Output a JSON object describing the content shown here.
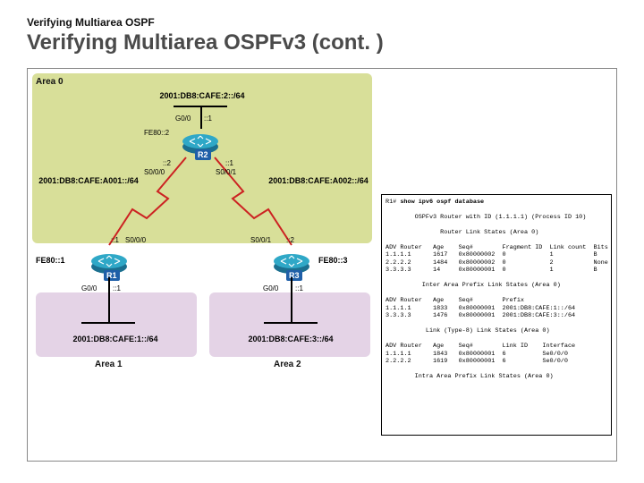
{
  "header": {
    "subtitle": "Verifying Multiarea OSPF",
    "title": "Verifying Multiarea OSPFv3 (cont. )"
  },
  "areas": {
    "a0": "Area 0",
    "a1": "Area 1",
    "a2": "Area 2"
  },
  "routers": {
    "r1": "R1",
    "r2": "R2",
    "r3": "R3"
  },
  "networks": {
    "top": "2001:DB8:CAFE:2::/64",
    "left": "2001:DB8:CAFE:A001::/64",
    "right": "2001:DB8:CAFE:A002::/64",
    "bottomLeft": "2001:DB8:CAFE:1::/64",
    "bottomRight": "2001:DB8:CAFE:3::/64"
  },
  "fe80": {
    "r1": "FE80::1",
    "r2": "FE80::2",
    "r3": "FE80::3"
  },
  "ifs": {
    "r2g": "G0/0",
    "r2g_sub": "::1",
    "r2s0": "S0/0/0",
    "r2s0_sub": "::2",
    "r2s1": "S0/0/1",
    "r2s1_sub": "::1",
    "r1s": "S0/0/0",
    "r1s_sub": "::1",
    "r3s": "S0/0/1",
    "r3s_sub": "::2",
    "r1g": "G0/0",
    "r1g_sub": "::1",
    "r3g": "G0/0",
    "r3g_sub": "::1"
  },
  "cli": {
    "prompt": "R1# ",
    "cmd": "show ipv6 ospf database",
    "line1": "        OSPFv3 Router with ID (1.1.1.1) (Process ID 10)",
    "line2": "               Router Link States (Area 0)",
    "h1": "ADV Router   Age    Seq#        Fragment ID  Link count  Bits",
    "r1a": "1.1.1.1      1617   0x80000002  0            1           B",
    "r1b": "2.2.2.2      1484   0x80000002  0            2           None",
    "r1c": "3.3.3.3      14     0x80000001  0            1           B",
    "line3": "          Inter Area Prefix Link States (Area 0)",
    "h2": "ADV Router   Age    Seq#        Prefix",
    "r2a": "1.1.1.1      1833   0x80000001  2001:DB8:CAFE:1::/64",
    "r2b": "3.3.3.3      1476   0x80000001  2001:DB8:CAFE:3::/64",
    "line4": "           Link (Type-8) Link States (Area 0)",
    "h3": "ADV Router   Age    Seq#        Link ID    Interface",
    "r3a": "1.1.1.1      1843   0x80000001  6          Se0/0/0",
    "r3b": "2.2.2.2      1619   0x80000001  6          Se0/0/0",
    "line5": "        Intra Area Prefix Link States (Area 0)"
  }
}
